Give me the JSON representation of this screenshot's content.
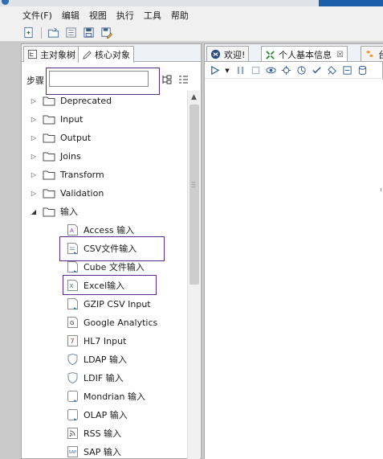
{
  "menubar": {
    "items": [
      "文件(F)",
      "编辑",
      "视图",
      "执行",
      "工具",
      "帮助"
    ]
  },
  "toolbar": {
    "buttons": [
      "new-icon",
      "open-icon",
      "explore-icon",
      "save-icon",
      "save-as-icon"
    ]
  },
  "left_panel": {
    "tabs": [
      {
        "label": "主对象树",
        "icon": "tree-icon"
      },
      {
        "label": "核心对象",
        "icon": "pencil-icon"
      }
    ],
    "active_tab": 1,
    "steps_label": "步骤",
    "search_value": "",
    "tree": [
      {
        "label": "Deprecated",
        "expanded": false,
        "kind": "folder"
      },
      {
        "label": "Input",
        "expanded": false,
        "kind": "folder"
      },
      {
        "label": "Output",
        "expanded": false,
        "kind": "folder"
      },
      {
        "label": "Joins",
        "expanded": false,
        "kind": "folder"
      },
      {
        "label": "Transform",
        "expanded": false,
        "kind": "folder"
      },
      {
        "label": "Validation",
        "expanded": false,
        "kind": "folder"
      },
      {
        "label": "输入",
        "expanded": true,
        "kind": "folder"
      },
      {
        "label": "Access 输入",
        "kind": "step",
        "icon": "access-icon"
      },
      {
        "label": "CSV文件输入",
        "kind": "step",
        "icon": "csv-icon"
      },
      {
        "label": "Cube 文件输入",
        "kind": "step",
        "icon": "cube-icon"
      },
      {
        "label": "Excel输入",
        "kind": "step",
        "icon": "excel-icon"
      },
      {
        "label": "GZIP CSV Input",
        "kind": "step",
        "icon": "gzip-icon"
      },
      {
        "label": "Google Analytics",
        "kind": "step",
        "icon": "google-analytics-icon"
      },
      {
        "label": "HL7 Input",
        "kind": "step",
        "icon": "hl7-icon"
      },
      {
        "label": "LDAP 输入",
        "kind": "step",
        "icon": "ldap-icon"
      },
      {
        "label": "LDIF 输入",
        "kind": "step",
        "icon": "ldif-icon"
      },
      {
        "label": "Mondrian 输入",
        "kind": "step",
        "icon": "mondrian-icon"
      },
      {
        "label": "OLAP 输入",
        "kind": "step",
        "icon": "olap-icon"
      },
      {
        "label": "RSS 输入",
        "kind": "step",
        "icon": "rss-icon"
      },
      {
        "label": "SAP 输入",
        "kind": "step",
        "icon": "sap-icon"
      }
    ]
  },
  "right_panel": {
    "tabs": [
      {
        "label": "欢迎!",
        "icon": "welcome-icon",
        "closable": false
      },
      {
        "label": "个人基本信息",
        "icon": "transformation-icon",
        "closable": true,
        "close_glyph": "☒"
      },
      {
        "label": "台",
        "icon": "job-icon",
        "closable": false
      }
    ],
    "active_tab": 1,
    "canvas_toolbar": [
      "run-icon",
      "run-options-icon",
      "pause-icon",
      "stop-icon",
      "preview-icon",
      "debug-icon",
      "replay-icon",
      "verify-icon",
      "impact-icon",
      "sql-icon",
      "explore-db-icon"
    ]
  },
  "colors": {
    "highlight": "#5b2a86",
    "title_accent": "#1c5ea8"
  }
}
